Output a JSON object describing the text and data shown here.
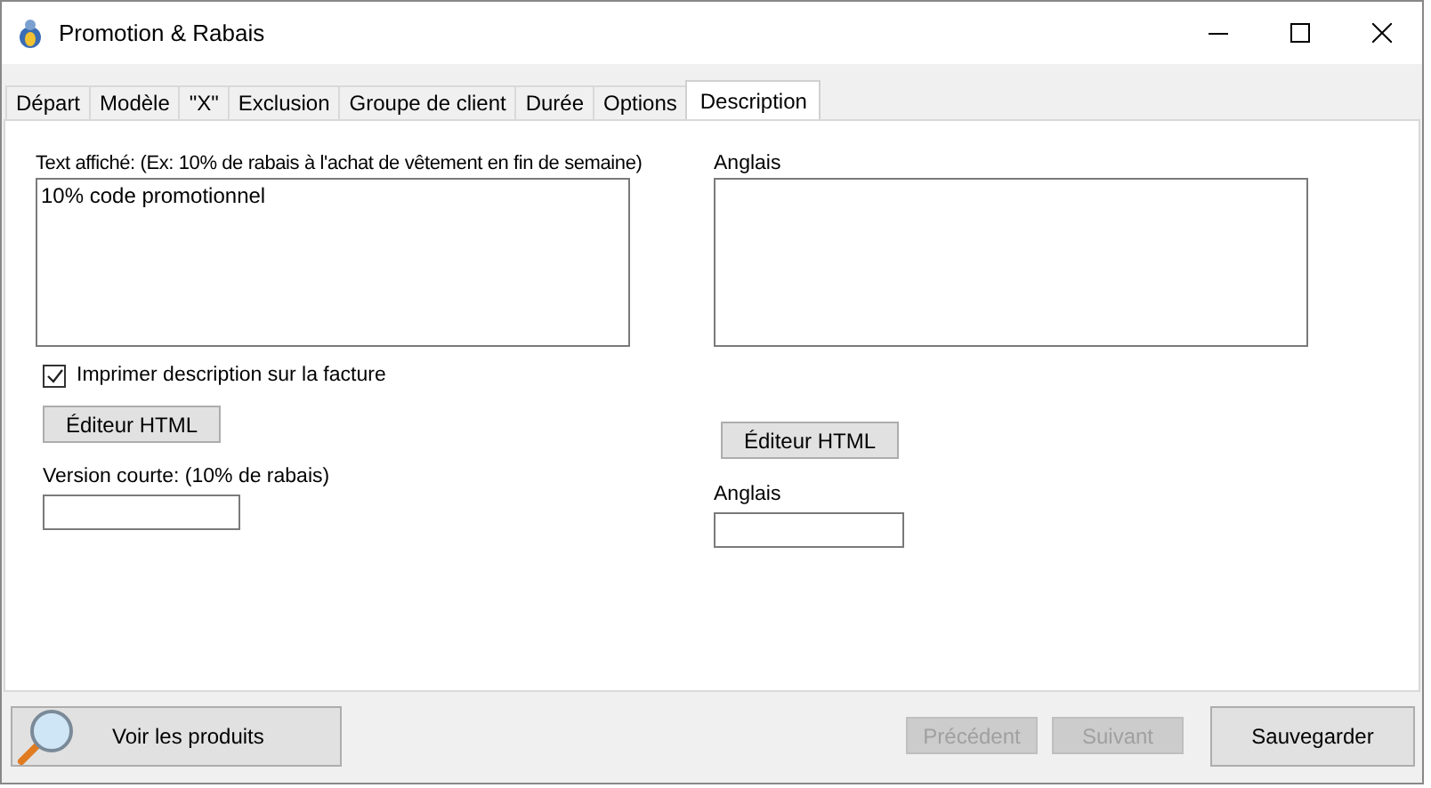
{
  "window": {
    "title": "Promotion & Rabais"
  },
  "tabs": [
    {
      "label": "Départ",
      "selected": false
    },
    {
      "label": "Modèle",
      "selected": false
    },
    {
      "label": "\"X\"",
      "selected": false
    },
    {
      "label": "Exclusion",
      "selected": false
    },
    {
      "label": "Groupe de client",
      "selected": false
    },
    {
      "label": "Durée",
      "selected": false
    },
    {
      "label": "Options",
      "selected": false
    },
    {
      "label": "Description",
      "selected": true
    }
  ],
  "left": {
    "text_label": "Text affiché: (Ex: 10% de rabais à l'achat de vêtement en fin de semaine)",
    "text_value": "10% code promotionnel",
    "print_checkbox": {
      "label": "Imprimer description sur la facture",
      "checked": true
    },
    "html_button": "Éditeur HTML",
    "short_label": "Version courte: (10% de rabais)"
  },
  "right": {
    "text_label": "Anglais",
    "html_button": "Éditeur HTML",
    "short_label": "Anglais"
  },
  "footer": {
    "products_button": "Voir les produits",
    "buttons": [
      {
        "label": "Précédent",
        "disabled": true
      },
      {
        "label": "Suivant",
        "disabled": true
      },
      {
        "label": "Sauvegarder",
        "disabled": false
      }
    ]
  }
}
